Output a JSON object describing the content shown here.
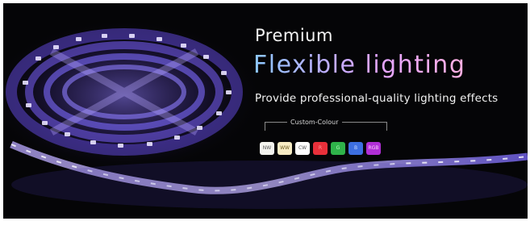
{
  "banner": {
    "heading": "Premium",
    "title": "Flexible lighting",
    "tagline": "Provide professional-quality lighting effects",
    "custom_colour_label": "Custom-Colour",
    "swatches": [
      {
        "label": "NW",
        "color": "#f3f3ee",
        "text_color": "#555555"
      },
      {
        "label": "WW",
        "color": "#f7ecc4",
        "text_color": "#6b5a20"
      },
      {
        "label": "CW",
        "color": "#ffffff",
        "text_color": "#555555"
      },
      {
        "label": "R",
        "color": "#e8303a",
        "text_color": "#ff9b9b"
      },
      {
        "label": "G",
        "color": "#2fb24a",
        "text_color": "#b8ffbe"
      },
      {
        "label": "B",
        "color": "#3d6fe0",
        "text_color": "#c9d8ff"
      },
      {
        "label": "RGB",
        "color": "#b02fd6",
        "text_color": "#ffd0ff"
      }
    ]
  }
}
